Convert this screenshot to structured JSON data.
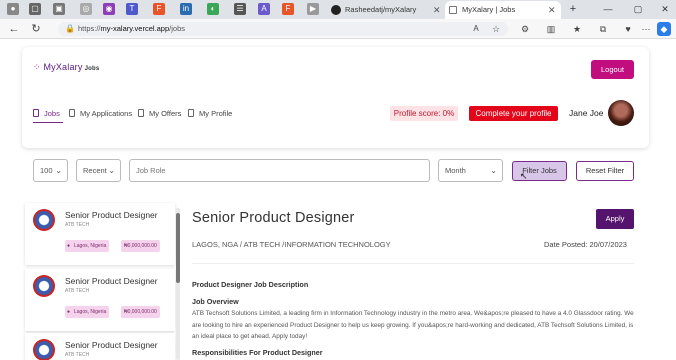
{
  "browser": {
    "tabs": [
      {
        "label": "Rasheedatj/myXalary",
        "icon": "github-icon"
      },
      {
        "label": "MyXalary | Jobs",
        "icon": "page-icon"
      }
    ],
    "url_prefix": "https://",
    "url_host": "my-xalary.vercel.app",
    "url_path": "/jobs"
  },
  "header": {
    "logo_text": "MyXalary",
    "logo_sub": "Jobs",
    "logout_label": "Logout"
  },
  "nav": {
    "tabs": [
      "Jobs",
      "My Applications",
      "My Offers",
      "My Profile"
    ]
  },
  "profile": {
    "score_label": "Profile score: 0%",
    "complete_label": "Complete your profile",
    "user_name": "Jane Joe"
  },
  "filters": {
    "page_size": "100",
    "sort": "Recent",
    "role_placeholder": "Job Role",
    "period": "Month",
    "filter_label": "Filter Jobs",
    "reset_label": "Reset Filter"
  },
  "jobs": [
    {
      "title": "Senior Product Designer",
      "company": "ATB TECH",
      "location": "Lagos, Nigeria",
      "salary": "₦0,000,000.00"
    },
    {
      "title": "Senior Product Designer",
      "company": "ATB TECH",
      "location": "Lagos, Nigeria",
      "salary": "₦0,000,000.00"
    },
    {
      "title": "Senior Product Designer",
      "company": "ATB TECH"
    }
  ],
  "detail": {
    "title": "Senior Product Designer",
    "apply_label": "Apply",
    "location_line": "LAGOS, NGA / ATB TECH /INFORMATION TECHNOLOGY",
    "date_posted": "Date Posted: 20/07/2023",
    "desc_heading": "Product Designer Job Description",
    "overview_heading": "Job Overview",
    "overview_text": "ATB Techsoft Solutions Limited, a leading firm in Information Technology industry in the metro area. We&apos;re pleased to have a 4.0 Glassdoor rating. We are looking to hire an experienced Product Designer to help us keep growing. If you&apos;re hard-working and dedicated, ATB Techsoft Solutions Limited, is an ideal place to get ahead. Apply today!",
    "resp_heading": "Responsibilities For Product Designer"
  }
}
